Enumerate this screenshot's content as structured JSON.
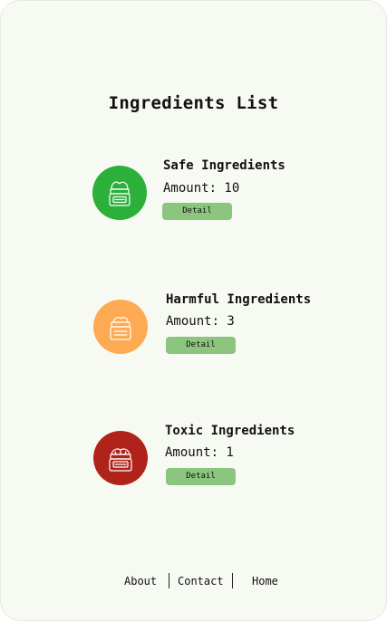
{
  "page": {
    "title": "Ingredients List"
  },
  "items": [
    {
      "title": "Safe Ingredients",
      "amount_text": "Amount: 10",
      "button_label": "Detail",
      "icon": "cream-jar-icon",
      "color": "#2bb03a"
    },
    {
      "title": "Harmful Ingredients",
      "amount_text": "Amount: 3",
      "button_label": "Detail",
      "icon": "cream-jar-icon",
      "color": "#fdaa52"
    },
    {
      "title": "Toxic Ingredients",
      "amount_text": "Amount: 1",
      "button_label": "Detail",
      "icon": "cream-jar-icon",
      "color": "#b0231a"
    }
  ],
  "footer": {
    "about": "About",
    "contact": "Contact",
    "home": "Home"
  },
  "theme": {
    "background": "#f7faf3",
    "button": "#8cc57e"
  }
}
